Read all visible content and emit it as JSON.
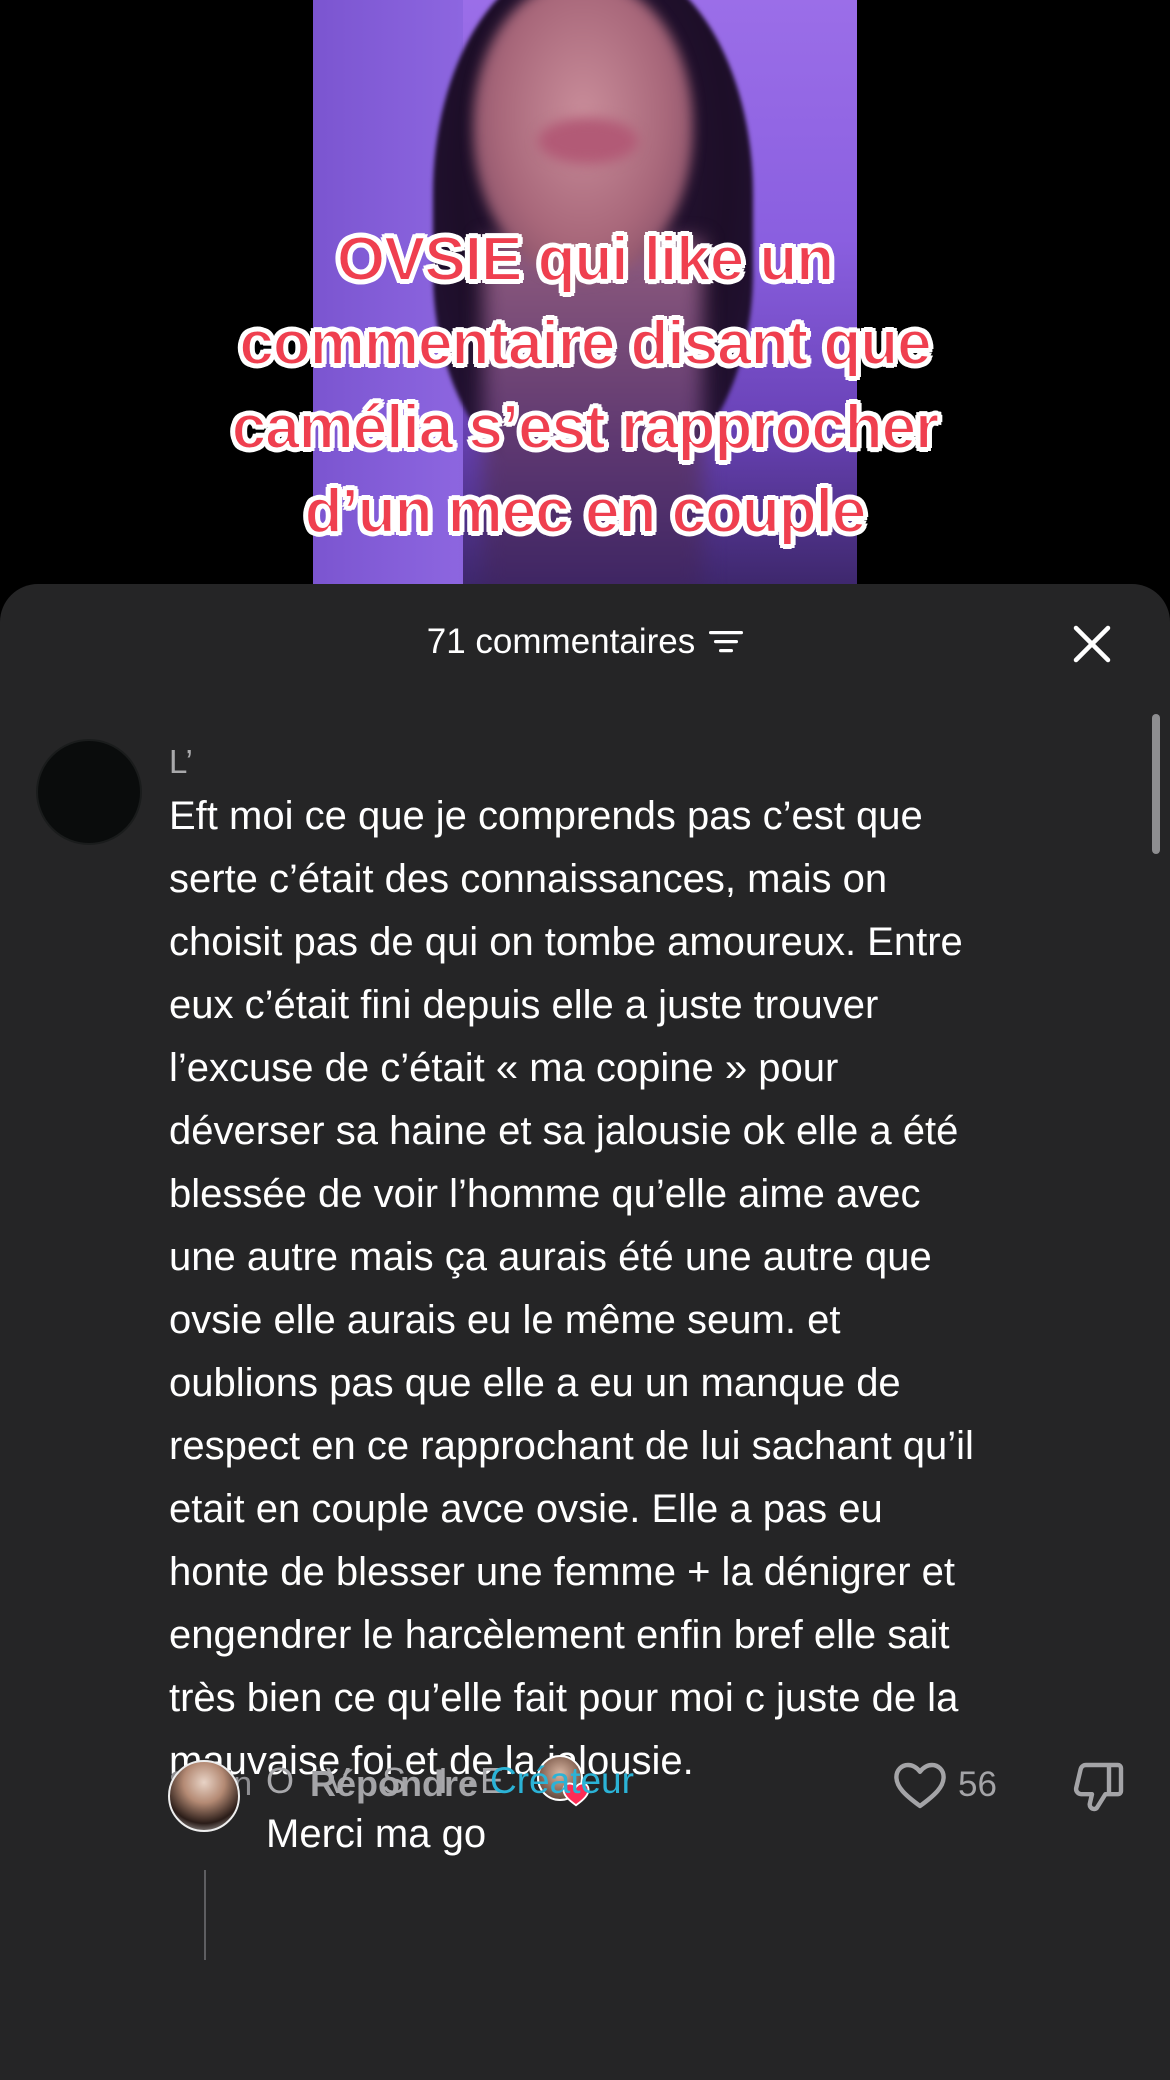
{
  "video": {
    "caption_lines": [
      "OVSIE qui like un",
      "commentaire disant que",
      "camélia s’est rapprocher",
      "d’un mec en couple"
    ]
  },
  "comments_sheet": {
    "count_label": "71 commentaires",
    "filter_icon": "sort-lines-icon",
    "close_icon": "close-x-icon",
    "comment": {
      "username": "L’",
      "text_lines": [
        "Eft moi ce que je comprends pas c’est que",
        "serte c’était des connaissances, mais on",
        "choisit pas de qui on tombe amoureux. Entre",
        "eux c’était fini depuis elle a juste trouver",
        "l’excuse de c’était « ma copine » pour",
        "déverser sa haine et sa jalousie ok elle a été",
        "blessée de voir l’homme qu’elle aime avec",
        "une autre mais ça aurais été une autre que",
        "ovsie elle aurais eu le même seum. et",
        "oublions pas que elle a eu un manque de",
        "respect en ce rapprochant de lui sachant qu’il",
        "etait en couple avce ovsie. Elle a pas eu",
        "honte de blesser une femme + la dénigrer et",
        "engendrer le harcèlement enfin bref elle sait",
        "très bien ce qu’elle fait pour moi c juste de la",
        "mauvaise foi et de la jalousie."
      ],
      "time": "8 min",
      "reply_label": "Répondre",
      "like_count": "56",
      "creator_liked": true
    },
    "reply": {
      "author": "O V S I E",
      "separator": "·",
      "badge": "Créateur",
      "text": "Merci ma go"
    }
  },
  "colors": {
    "sheet_bg": "#252526",
    "caption_red": "#ef3f4f",
    "creator_blue": "#2bb3d6",
    "heart_red": "#fe2c55"
  }
}
